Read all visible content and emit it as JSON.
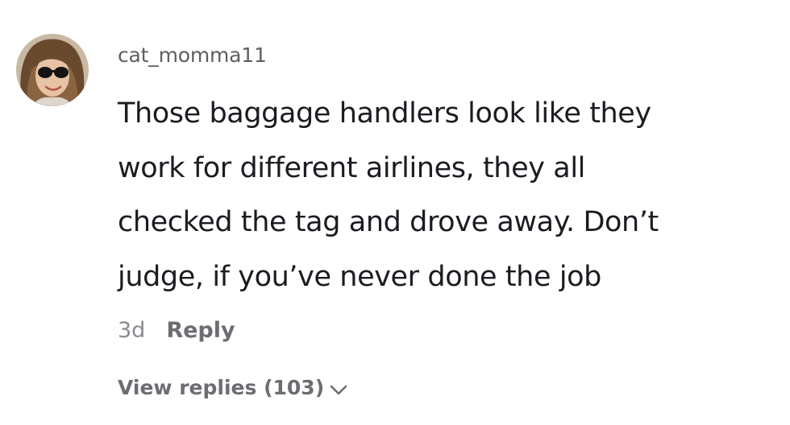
{
  "comment": {
    "username": "cat_momma11",
    "text_lines": [
      "Those baggage handlers look like they",
      "work for different airlines, they all",
      "checked the tag and drove away. Don’t",
      "judge, if you’ve never done the job"
    ],
    "timestamp": "3d",
    "reply_label": "Reply",
    "view_replies_label": "View replies (103)",
    "icons": {
      "expand": "chevron-down-icon"
    },
    "colors": {
      "username": "#5e5f63",
      "text": "#1b1c21",
      "secondary": "#6c6d72",
      "timestamp": "#8a8b91"
    }
  }
}
